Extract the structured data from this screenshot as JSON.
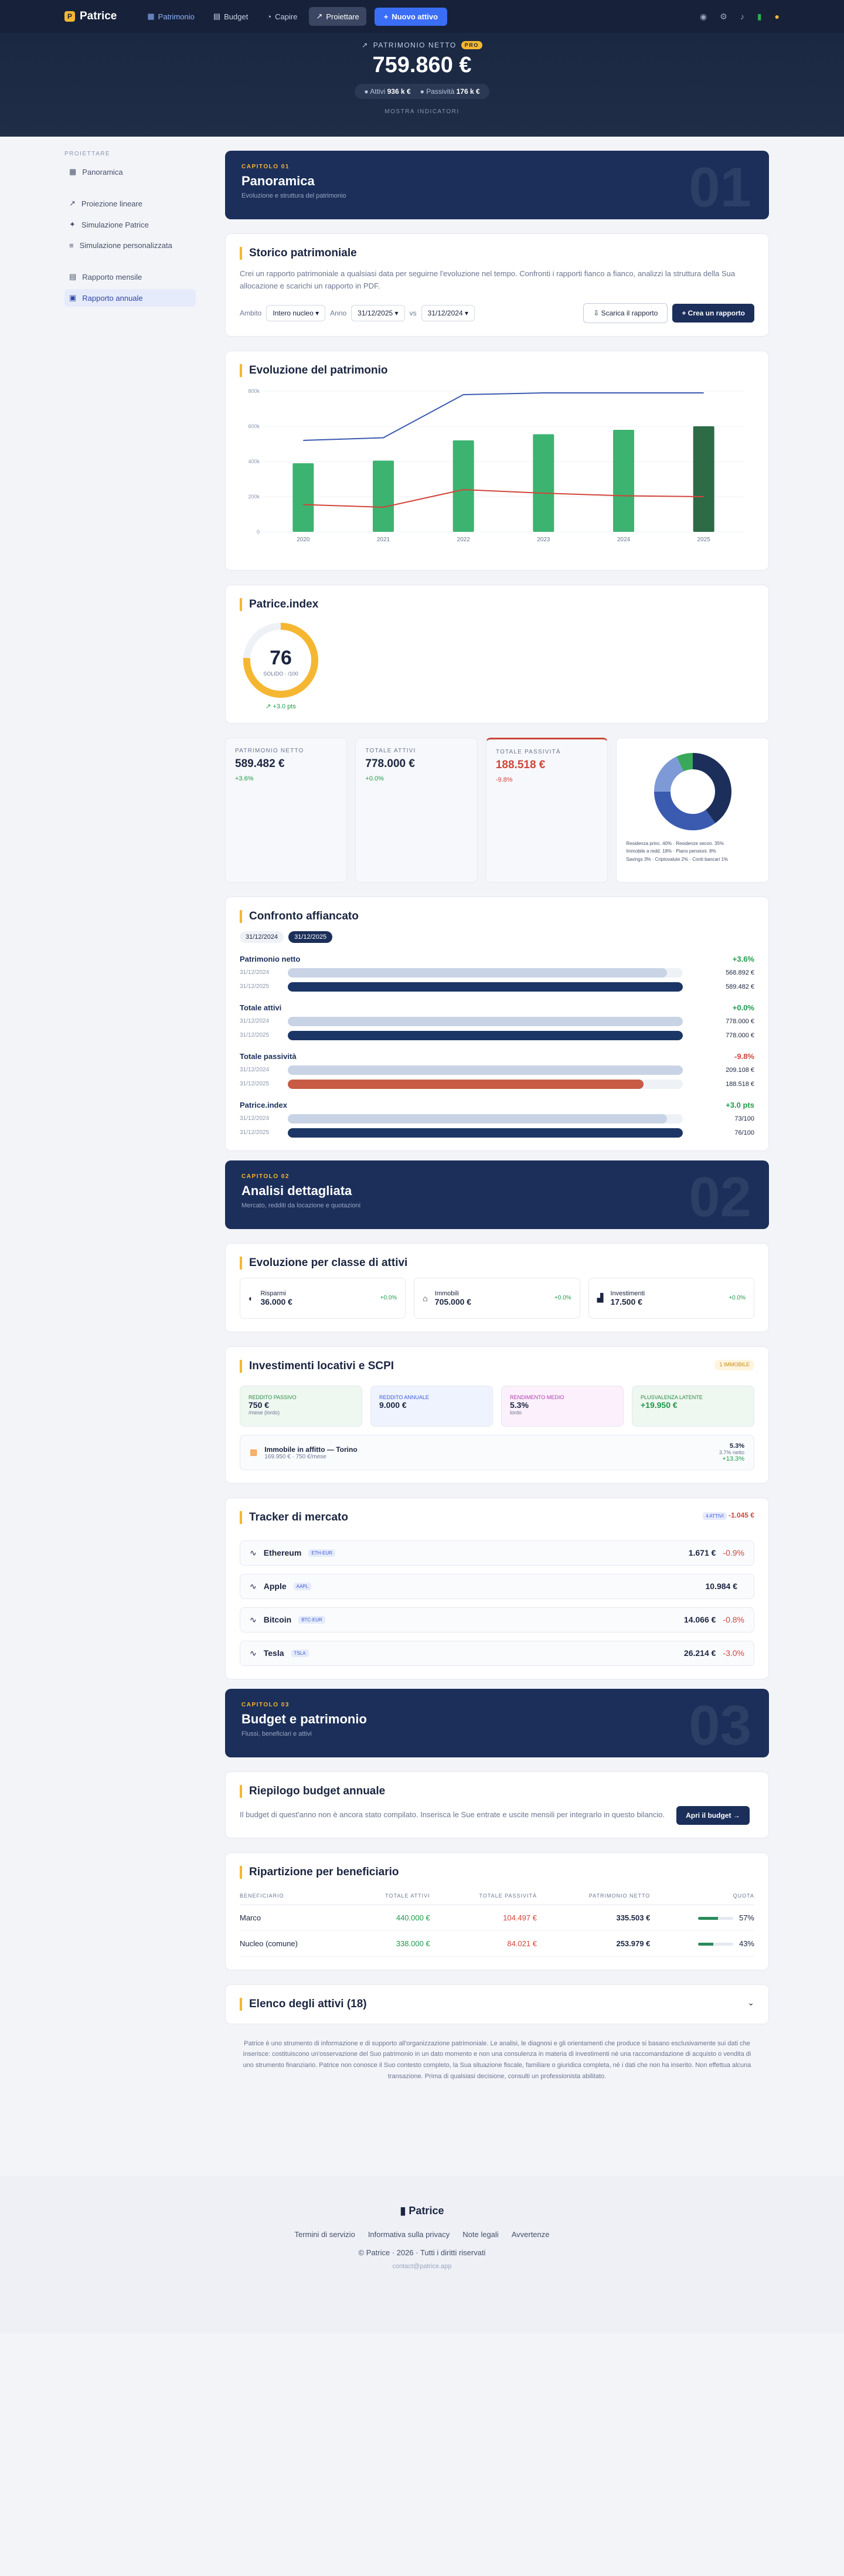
{
  "nav": {
    "brand": "Patrice",
    "items": [
      "Patrimonio",
      "Budget",
      "Capire",
      "Proiettare"
    ],
    "new_asset": "Nuovo attivo"
  },
  "hero": {
    "label": "PATRIMONIO NETTO",
    "badge": "PRO",
    "value": "759.860 €",
    "assets_label": "Attivi",
    "assets": "936 k €",
    "liab_label": "Passività",
    "liab": "176 k €",
    "more": "MOSTRA INDICATORI"
  },
  "sidebar": {
    "title": "PROIETTARE",
    "items": [
      "Panoramica",
      "Proiezione lineare",
      "Simulazione Patrice",
      "Simulazione personalizzata",
      "Rapporto mensile",
      "Rapporto annuale"
    ]
  },
  "chap1": {
    "k": "CAPITOLO 01",
    "t": "Panoramica",
    "s": "Evoluzione e struttura del patrimonio",
    "n": "01"
  },
  "history": {
    "title": "Storico patrimoniale",
    "text": "Crei un rapporto patrimoniale a qualsiasi data per seguirne l'evoluzione nel tempo. Confronti i rapporti fianco a fianco, analizzi la struttura della Sua allocazione e scarichi un rapporto in PDF.",
    "scope_label": "Ambito",
    "scope": "Intero nucleo",
    "year_label": "Anno",
    "date1": "31/12/2025",
    "vs": "vs",
    "date2": "31/12/2024",
    "download": "Scarica il rapporto",
    "create": "Crea un rapporto"
  },
  "evo": {
    "title": "Evoluzione del patrimonio"
  },
  "chart_data": {
    "type": "bar",
    "categories": [
      "2020",
      "2021",
      "2022",
      "2023",
      "2024",
      "2025"
    ],
    "values": [
      390000,
      405000,
      520000,
      555000,
      580000,
      600000
    ],
    "ylim": [
      0,
      800000
    ],
    "yticks": [
      "0",
      "200k",
      "400k",
      "600k",
      "800k"
    ],
    "lines": [
      {
        "values": [
          520000,
          535000,
          780000,
          790000,
          790000,
          790000
        ]
      },
      {
        "values": [
          155000,
          140000,
          240000,
          220000,
          205000,
          200000
        ]
      }
    ]
  },
  "index": {
    "title": "Patrice.index",
    "score": "76",
    "sub": "SOLIDO · /100",
    "delta": "+3.0 pts"
  },
  "stats": [
    {
      "k": "PATRIMONIO NETTO",
      "v": "589.482 €",
      "d": "+3.6%"
    },
    {
      "k": "TOTALE ATTIVI",
      "v": "778.000 €",
      "d": "+0.0%"
    },
    {
      "k": "TOTALE PASSIVITÀ",
      "v": "188.518 €",
      "d": "-9.8%"
    }
  ],
  "legend": [
    "Residenza princ. 40%",
    "Residenze secon. 35%",
    "Immobile a redd. 18%",
    "Piano pensioni. 8%",
    "Savings 3%",
    "Criptovalute 2%",
    "Conti bancari 1%"
  ],
  "compare": {
    "title": "Confronto affiancato",
    "d1": "31/12/2024",
    "d2": "31/12/2025",
    "groups": [
      {
        "name": "Patrimonio netto",
        "delta": "+3.6%",
        "v1": "568.892 €",
        "v2": "589.482 €"
      },
      {
        "name": "Totale attivi",
        "delta": "+0.0%",
        "v1": "778.000 €",
        "v2": "778.000 €"
      },
      {
        "name": "Totale passività",
        "delta": "-9.8%",
        "v1": "209.108 €",
        "v2": "188.518 €"
      },
      {
        "name": "Patrice.index",
        "delta": "+3.0 pts",
        "v1": "73/100",
        "v2": "76/100"
      }
    ]
  },
  "chap2": {
    "k": "CAPITOLO 02",
    "t": "Analisi dettagliata",
    "s": "Mercato, redditi da locazione e quotazioni",
    "n": "02"
  },
  "classes": {
    "title": "Evoluzione per classe di attivi",
    "items": [
      {
        "n": "Risparmi",
        "v": "36.000 €",
        "d": "+0.0%"
      },
      {
        "n": "Immobili",
        "v": "705.000 €",
        "d": "+0.0%"
      },
      {
        "n": "Investimenti",
        "v": "17.500 €",
        "d": "+0.0%"
      }
    ]
  },
  "rental": {
    "title": "Investimenti locativi e SCPI",
    "badge": "1 IMMOBILE",
    "kpis": [
      {
        "k": "REDDITO PASSIVO",
        "v": "750 €",
        "s": "/mese (lordo)"
      },
      {
        "k": "REDDITO ANNUALE",
        "v": "9.000 €",
        "s": ""
      },
      {
        "k": "RENDIMENTO MEDIO",
        "v": "5.3%",
        "s": "lordo"
      },
      {
        "k": "PLUSVALENZA LATENTE",
        "v": "+19.950 €",
        "s": ""
      }
    ],
    "prop": "Immobile in affitto — Torino",
    "prop_s": "169.950 € · 750 €/mese",
    "y1": "5.3%",
    "y2": "3.7% netto",
    "y3": "+13.3%"
  },
  "market": {
    "title": "Tracker di mercato",
    "badge": "4 ATTIVI",
    "total": "-1.045 €",
    "rows": [
      {
        "n": "Ethereum",
        "t": "ETH-EUR",
        "v": "1.671 €",
        "d": "-0.9%"
      },
      {
        "n": "Apple",
        "t": "AAPL",
        "v": "10.984 €",
        "d": ""
      },
      {
        "n": "Bitcoin",
        "t": "BTC-EUR",
        "v": "14.066 €",
        "d": "-0.8%"
      },
      {
        "n": "Tesla",
        "t": "TSLA",
        "v": "26.214 €",
        "d": "-3.0%"
      }
    ]
  },
  "chap3": {
    "k": "CAPITOLO 03",
    "t": "Budget e patrimonio",
    "s": "Flussi, beneficiari e attivi",
    "n": "03"
  },
  "budget": {
    "title": "Riepilogo budget annuale",
    "text": "Il budget di quest'anno non è ancora stato compilato. Inserisca le Sue entrate e uscite mensili per integrarlo in questo bilancio.",
    "btn": "Apri il budget →"
  },
  "benef": {
    "title": "Ripartizione per beneficiario",
    "cols": [
      "BENEFICIARIO",
      "TOTALE ATTIVI",
      "TOTALE PASSIVITÀ",
      "PATRIMONIO NETTO",
      "QUOTA"
    ],
    "rows": [
      {
        "n": "Marco",
        "a": "440.000 €",
        "p": "104.497 €",
        "net": "335.503 €",
        "q": "57%",
        "f": 0.57
      },
      {
        "n": "Nucleo (comune)",
        "a": "338.000 €",
        "p": "84.021 €",
        "net": "253.979 €",
        "q": "43%",
        "f": 0.43
      }
    ]
  },
  "assets": {
    "title": "Elenco degli attivi (18)"
  },
  "disclaimer": "Patrice è uno strumento di informazione e di supporto all'organizzazione patrimoniale. Le analisi, le diagnosi e gli orientamenti che produce si basano esclusivamente sui dati che inserisce: costituiscono un'osservazione del Suo patrimonio in un dato momento e non una consulenza in materia di investimenti né una raccomandazione di acquisto o vendita di uno strumento finanziario. Patrice non conosce il Suo contesto completo, la Sua situazione fiscale, familiare o giuridica completa, né i dati che non ha inserito. Non effettua alcuna transazione. Prima di qualsiasi decisione, consulti un professionista abilitato.",
  "footer": {
    "brand": "Patrice",
    "links": [
      "Termini di servizio",
      "Informativa sulla privacy",
      "Note legali",
      "Avvertenze"
    ],
    "copy": "© Patrice · 2026 · Tutti i diritti riservati",
    "mail": "contact@patrice.app"
  }
}
